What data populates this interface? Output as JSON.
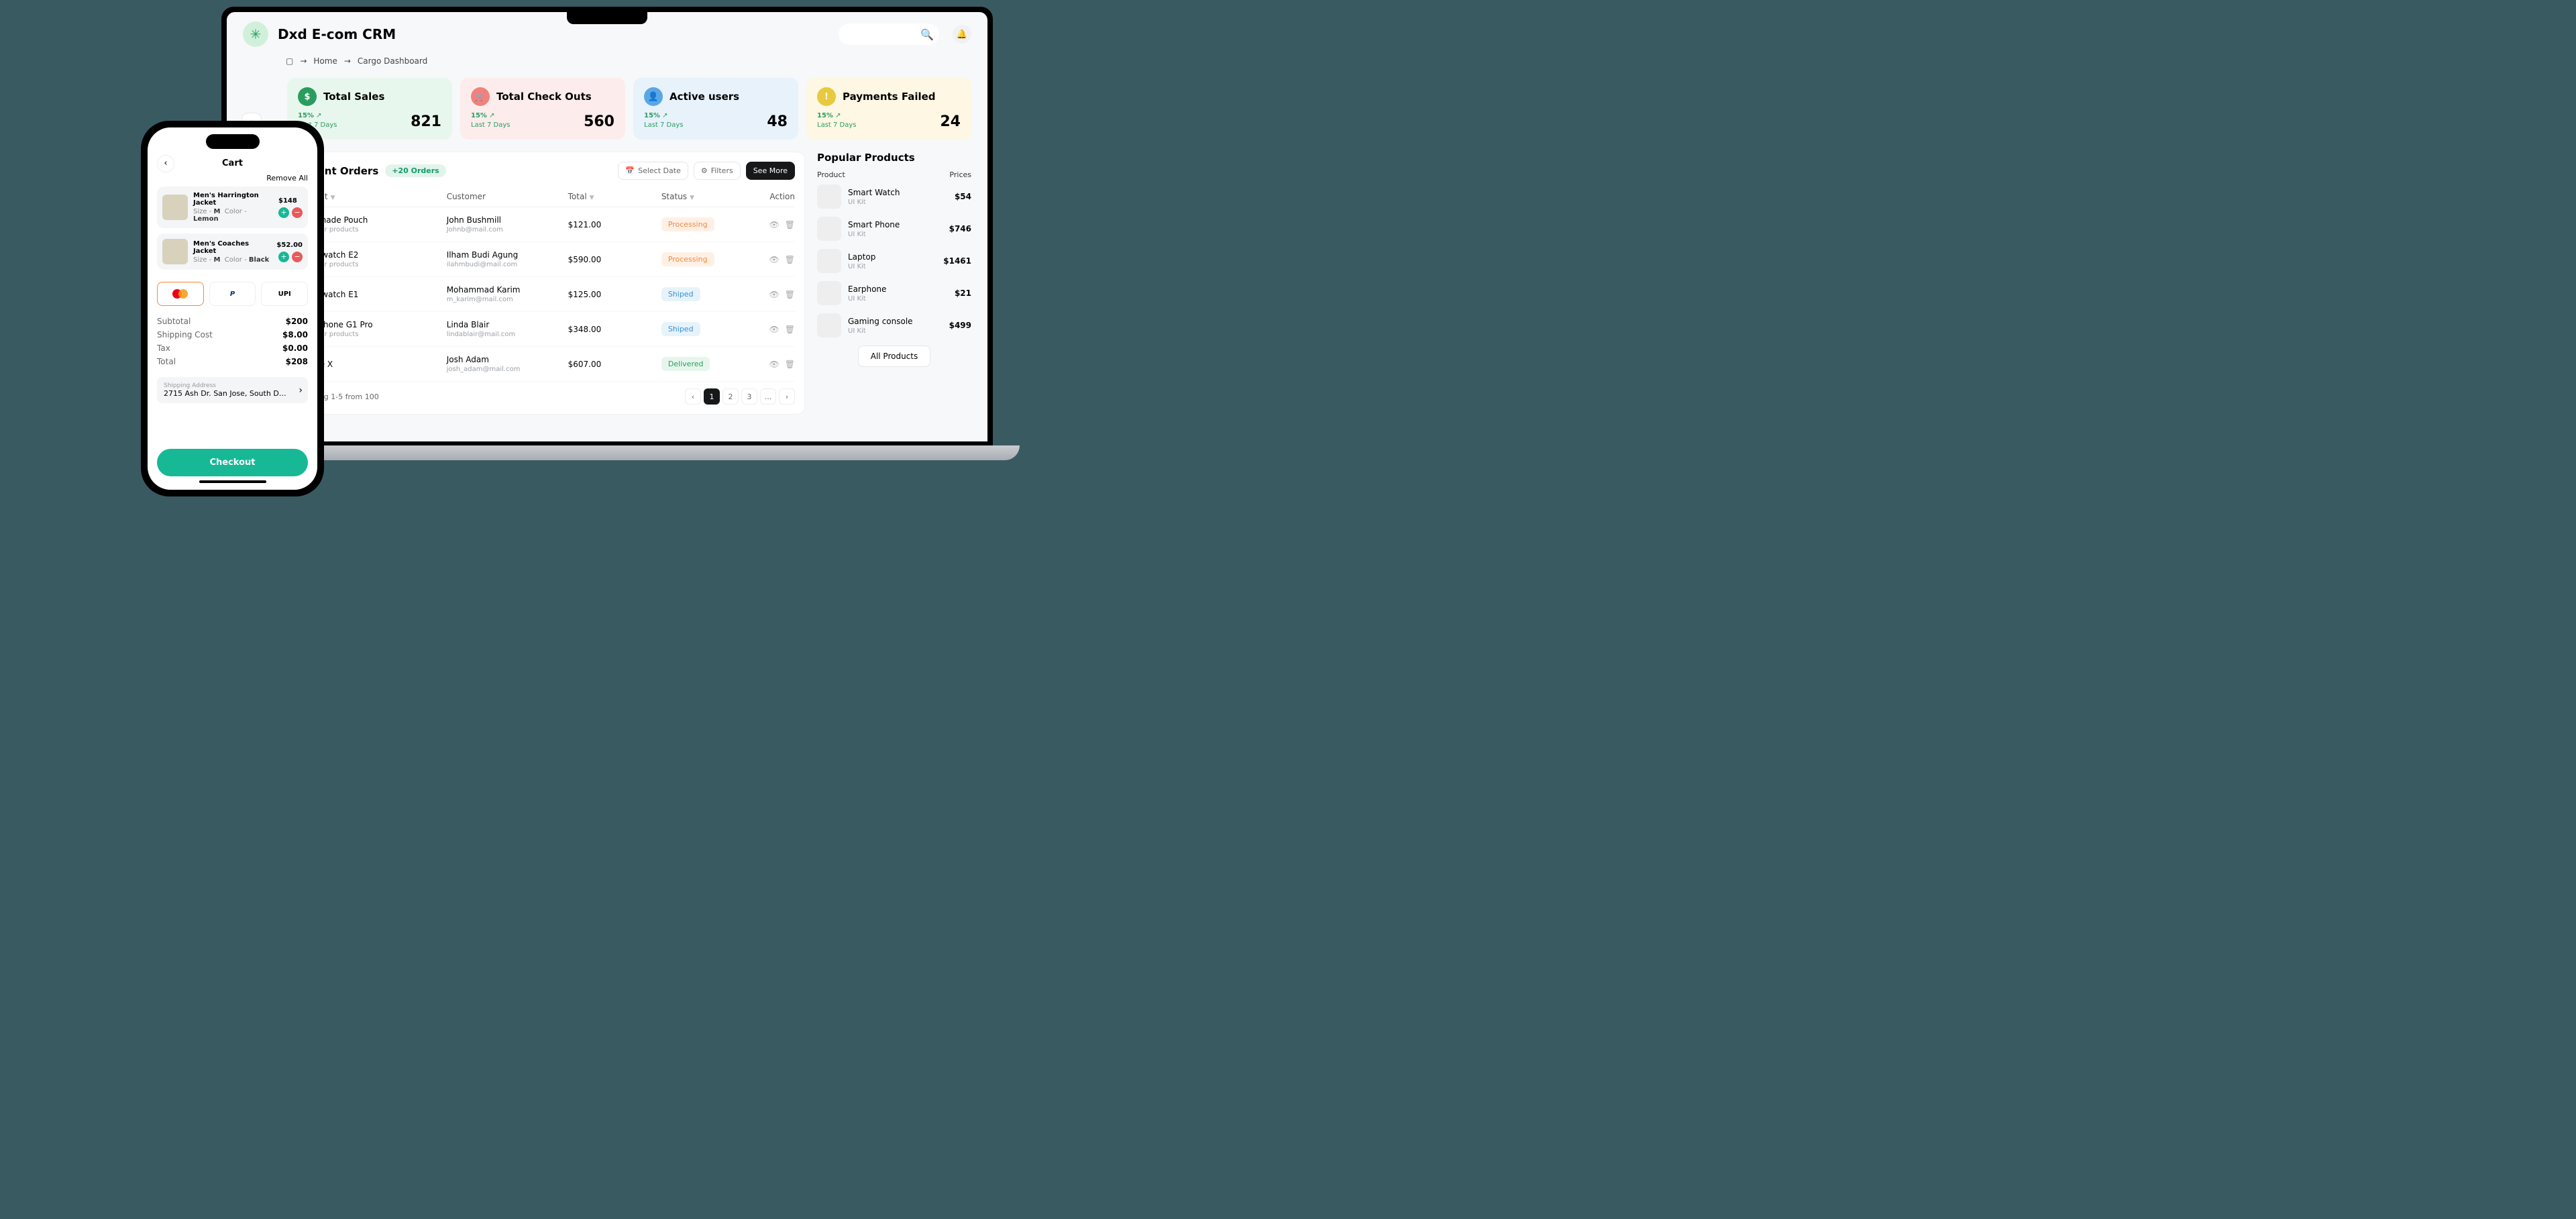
{
  "desktop": {
    "app_title": "Dxd E-com CRM",
    "crumb_home": "Home",
    "crumb_page": "Cargo Dashboard",
    "cards": [
      {
        "title": "Total Sales",
        "pct": "15%",
        "period": "Last 7 Days",
        "value": "821"
      },
      {
        "title": "Total Check Outs",
        "pct": "15%",
        "period": "Last 7 Days",
        "value": "560"
      },
      {
        "title": "Active users",
        "pct": "15%",
        "period": "Last 7 Days",
        "value": "48"
      },
      {
        "title": "Payments Failed",
        "pct": "15%",
        "period": "Last 7 Days",
        "value": "24"
      }
    ],
    "orders": {
      "title": "Recent Orders",
      "chip": "+20 Orders",
      "select_date": "Select Date",
      "filters": "Filters",
      "see_more": "See More",
      "th_product": "Product",
      "th_customer": "Customer",
      "th_total": "Total",
      "th_status": "Status",
      "th_action": "Action",
      "rows": [
        {
          "product": "Handmade Pouch",
          "psub": "+3 other products",
          "customer": "John Bushmill",
          "email": "Johnb@mail.com",
          "total": "$121.00",
          "status": "Processing",
          "scls": "st-proc"
        },
        {
          "product": "Smartwatch E2",
          "psub": "+1 other products",
          "customer": "Ilham Budi Agung",
          "email": "ilahmbudi@mail.com",
          "total": "$590.00",
          "status": "Processing",
          "scls": "st-proc"
        },
        {
          "product": "Smartwatch E1",
          "psub": "",
          "customer": "Mohammad Karim",
          "email": "m_karim@mail.com",
          "total": "$125.00",
          "status": "Shiped",
          "scls": "st-ship"
        },
        {
          "product": "Headphone G1 Pro",
          "psub": "+1 other products",
          "customer": "Linda Blair",
          "email": "lindablair@mail.com",
          "total": "$348.00",
          "status": "Shiped",
          "scls": "st-ship"
        },
        {
          "product": "Iphone X",
          "psub": "",
          "customer": "Josh Adam",
          "email": "josh_adam@mail.com",
          "total": "$607.00",
          "status": "Delivered",
          "scls": "st-del"
        }
      ],
      "showing": "Showing 1-5 from 100",
      "pages": [
        "1",
        "2",
        "3",
        "..."
      ]
    },
    "popular": {
      "title": "Popular Products",
      "h_product": "Product",
      "h_prices": "Prices",
      "items": [
        {
          "name": "Smart Watch",
          "sub": "UI Kit",
          "price": "$54"
        },
        {
          "name": "Smart Phone",
          "sub": "UI Kit",
          "price": "$746"
        },
        {
          "name": "Laptop",
          "sub": "UI Kit",
          "price": "$1461"
        },
        {
          "name": "Earphone",
          "sub": "UI Kit",
          "price": "$21"
        },
        {
          "name": "Gaming console",
          "sub": "UI Kit",
          "price": "$499"
        }
      ],
      "all": "All Products"
    }
  },
  "phone": {
    "title": "Cart",
    "remove_all": "Remove All",
    "items": [
      {
        "name": "Men's Harrington Jacket",
        "size": "M",
        "color": "Lemon",
        "price": "$148"
      },
      {
        "name": "Men's Coaches Jacket",
        "size": "M",
        "color": "Black",
        "price": "$52.00"
      }
    ],
    "attr_size": "Size - ",
    "attr_color": "Color - ",
    "pay_upi": "UPI",
    "totals": {
      "subtotal_l": "Subtotal",
      "subtotal_v": "$200",
      "ship_l": "Shipping Cost",
      "ship_v": "$8.00",
      "tax_l": "Tax",
      "tax_v": "$0.00",
      "total_l": "Total",
      "total_v": "$208"
    },
    "ship_label": "Shipping Address",
    "ship_addr": "2715 Ash Dr. San Jose, South Dak...",
    "checkout": "Checkout"
  }
}
